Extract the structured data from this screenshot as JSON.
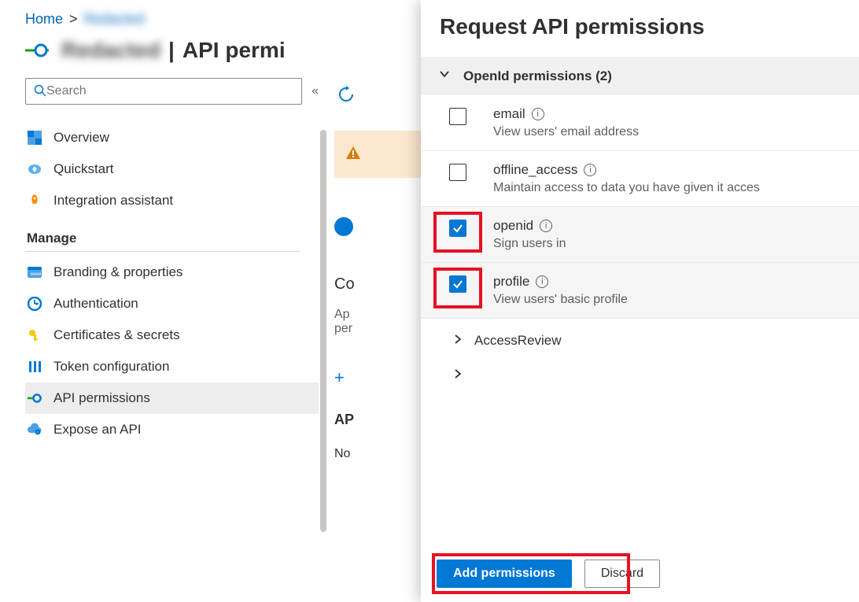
{
  "breadcrumb": {
    "home": "Home"
  },
  "page_title_suffix": "API permi",
  "search": {
    "placeholder": "Search"
  },
  "nav": {
    "overview": "Overview",
    "quickstart": "Quickstart",
    "integration": "Integration assistant"
  },
  "sections": {
    "manage": "Manage"
  },
  "manage_nav": {
    "branding": "Branding & properties",
    "auth": "Authentication",
    "certs": "Certificates & secrets",
    "token": "Token configuration",
    "api_perm": "API permissions",
    "expose": "Expose an API"
  },
  "center": {
    "frag1": "Co",
    "frag2a": "Ap",
    "frag2b": "per",
    "frag3": "AP",
    "frag4": "No"
  },
  "flyout": {
    "title": "Request API permissions",
    "group_openid": "OpenId permissions (2)",
    "perms": {
      "email": {
        "name": "email",
        "desc": "View users' email address"
      },
      "offline": {
        "name": "offline_access",
        "desc": "Maintain access to data you have given it acces"
      },
      "openid": {
        "name": "openid",
        "desc": "Sign users in"
      },
      "profile": {
        "name": "profile",
        "desc": "View users' basic profile"
      }
    },
    "subsection": "AccessReview",
    "add_btn": "Add permissions",
    "discard_btn": "Discard"
  }
}
